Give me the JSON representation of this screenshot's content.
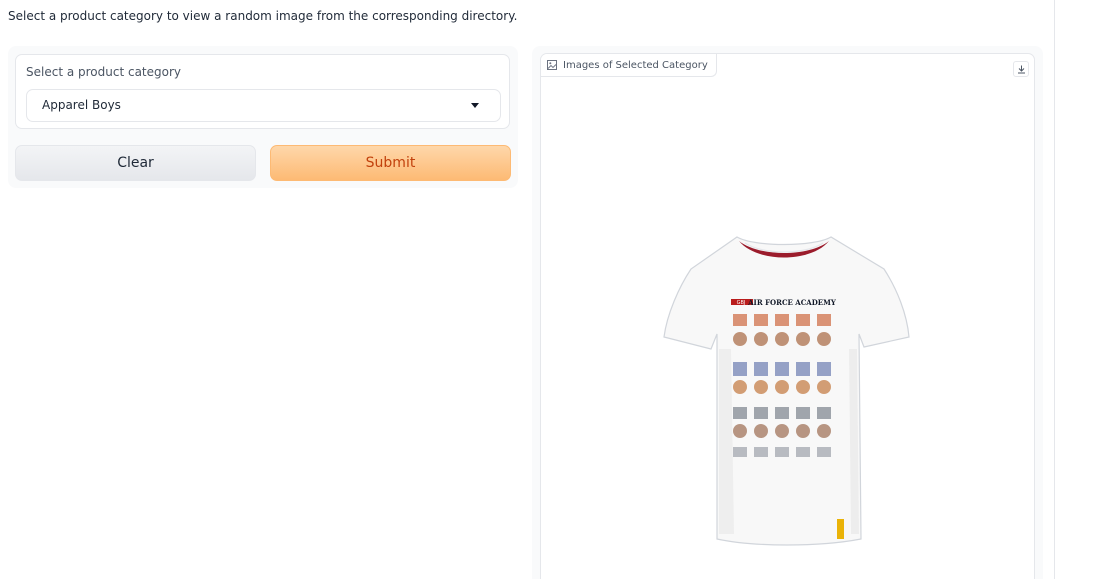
{
  "description": "Select a product category to view a random image from the corresponding directory.",
  "category_dropdown": {
    "label": "Select a product category",
    "selected_value": "Apparel Boys"
  },
  "buttons": {
    "clear_label": "Clear",
    "submit_label": "Submit"
  },
  "output_panel": {
    "label": "Images of Selected Category"
  },
  "product_image": {
    "print_text": "AIR FORCE ACADEMY",
    "print_badge": "GBJ"
  },
  "colors": {
    "submit_bg": "#fdba74",
    "submit_text": "#c2410c",
    "clear_bg": "#e5e7eb",
    "border": "#e5e7eb"
  }
}
